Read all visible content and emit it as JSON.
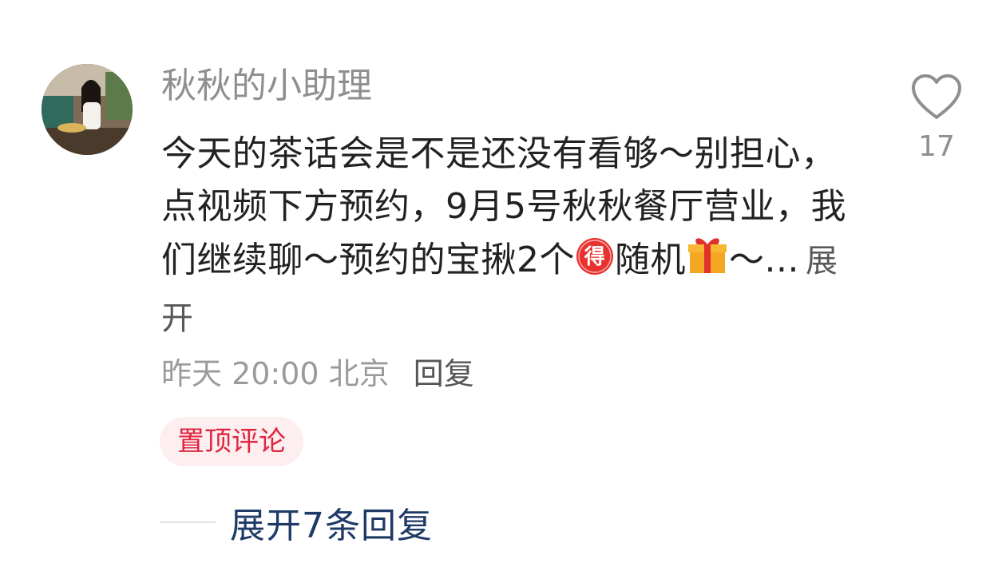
{
  "comment": {
    "username": "秋秋的小助理",
    "text_part1": "今天的茶话会是不是还没有看够～别担心，点视频下方预约，9月5号秋秋餐厅营业，我们继续聊～预约的宝揪2个",
    "text_part2": "随机",
    "text_part3": "～...",
    "expand_label": "展开",
    "timestamp": "昨天 20:00",
    "location": "北京",
    "reply_label": "回复",
    "pinned_tag": "置顶评论",
    "like_count": "17",
    "like_icon": "heart-outline-icon",
    "expand_replies_label": "展开7条回复"
  },
  "colors": {
    "pinned_text": "#e0263f",
    "pinned_bg": "#fdeef0",
    "replies_link": "#1e3a66",
    "username": "#8f8f8f"
  }
}
